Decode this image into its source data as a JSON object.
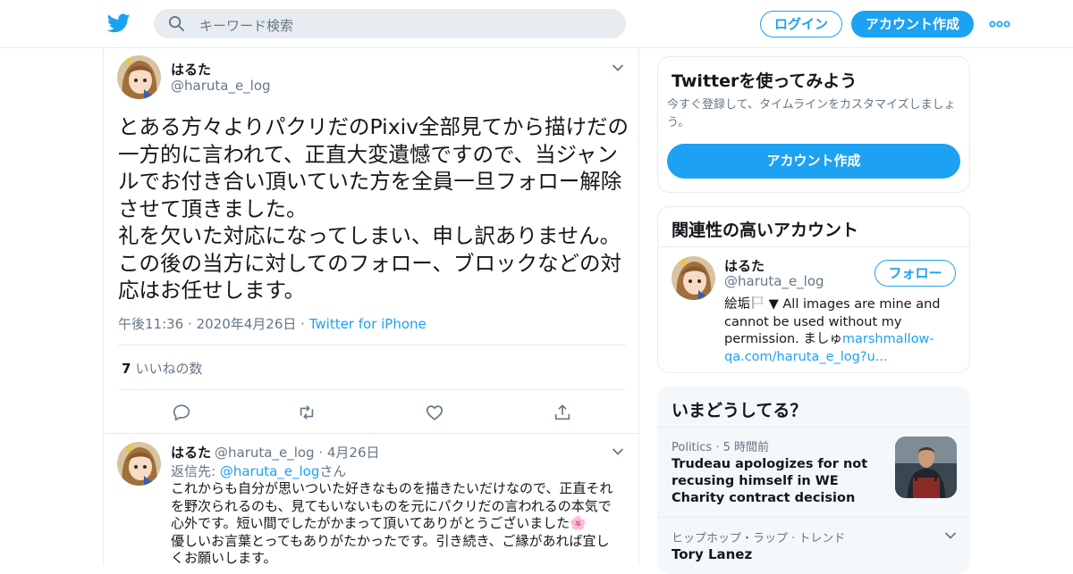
{
  "header": {
    "search_placeholder": "キーワード検索",
    "login_label": "ログイン",
    "signup_label": "アカウント作成"
  },
  "tweet": {
    "name": "はるた",
    "handle": "@haruta_e_log",
    "text": "とある方々よりパクリだのPixiv全部見てから描けだの一方的に言われて、正直大変遺憾ですので、当ジャンルでお付き合い頂いていた方を全員一旦フォロー解除させて頂きました。\n礼を欠いた対応になってしまい、申し訳ありません。\nこの後の当方に対してのフォロー、ブロックなどの対応はお任せします。",
    "time": "午後11:36",
    "date": "2020年4月26日",
    "source": "Twitter for iPhone",
    "likes_count": "7",
    "likes_label": "いいねの数"
  },
  "reply": {
    "name": "はるた",
    "handle": "@haruta_e_log",
    "date": "4月26日",
    "reply_prefix": "返信先: ",
    "reply_to": "@haruta_e_log",
    "reply_suffix": "さん",
    "text": "これからも自分が思いついた好きなものを描きたいだけなので、正直それを野次られるのも、見てもいないものを元にパクリだの言われるの本気で心外です。短い間でしたがかまって頂いてありがとうございました🌸\n優しいお言葉とってもありがたかったです。引き続き、ご縁があれば宜しくお願いします。"
  },
  "sidebar": {
    "signup_card": {
      "title": "Twitterを使ってみよう",
      "subtitle": "今すぐ登録して、タイムラインをカスタマイズしましょう。",
      "button": "アカウント作成"
    },
    "related_card": {
      "title": "関連性の高いアカウント",
      "name": "はるた",
      "handle": "@haruta_e_log",
      "follow_label": "フォロー",
      "bio_prefix": "絵垢",
      "bio_main": "▼ All images are mine and cannot be used without my permission. ましゅ",
      "bio_link": "marshmallow-qa.com/haruta_e_log?u..."
    },
    "trends_card": {
      "title": "いまどうしてる？",
      "item1_category": "Politics",
      "item1_time": "5 時間前",
      "item1_headline": "Trudeau apologizes for not recusing himself in WE Charity contract decision",
      "item2_category": "ヒップホップ・ラップ · トレンド",
      "item2_title": "Tory Lanez"
    }
  }
}
